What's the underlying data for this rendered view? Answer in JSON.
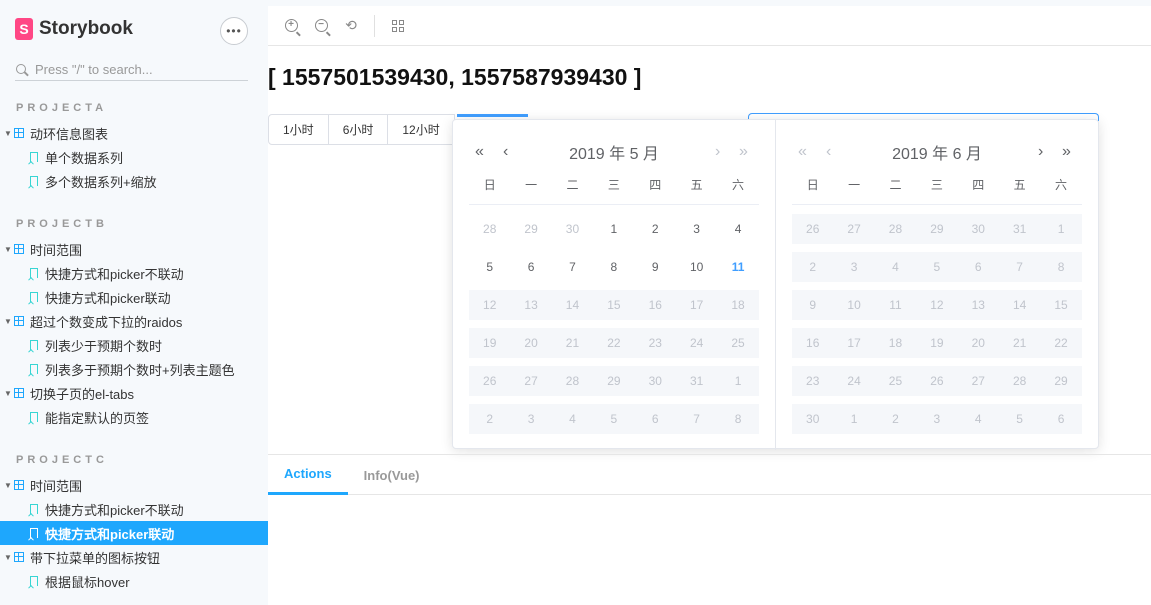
{
  "sidebar": {
    "brand": "Storybook",
    "brand_logo": "S",
    "menu_icon": "•••",
    "search_placeholder": "Press \"/\" to search...",
    "groups": [
      {
        "title": "PROJECTA"
      },
      {
        "title": "PROJECTB"
      },
      {
        "title": "PROJECTC"
      }
    ],
    "items": [
      "动环信息图表",
      "单个数据系列",
      "多个数据系列+缩放",
      "时间范围",
      "快捷方式和picker不联动",
      "快捷方式和picker联动",
      "超过个数变成下拉的raidos",
      "列表少于预期个数时",
      "列表多于预期个数时+列表主题色",
      "切换子页的el-tabs",
      "能指定默认的页签",
      "时间范围",
      "快捷方式和picker不联动",
      "快捷方式和picker联动",
      "带下拉菜单的图标按钮",
      "根据鼠标hover"
    ]
  },
  "toolbar": {
    "icons": [
      "zoom-in-icon",
      "zoom-out-icon",
      "zoom-reset-icon",
      "grid-icon"
    ]
  },
  "content": {
    "range_text": "[ 1557501539430, 1557587939430 ]",
    "quick_buttons": [
      "1小时",
      "6小时",
      "12小时"
    ]
  },
  "calendar": {
    "weekdays": [
      "日",
      "一",
      "二",
      "三",
      "四",
      "五",
      "六"
    ],
    "left": {
      "title": "2019 年 5 月",
      "rows": [
        [
          "28",
          "29",
          "30",
          "1",
          "2",
          "3",
          "4"
        ],
        [
          "5",
          "6",
          "7",
          "8",
          "9",
          "10",
          "11"
        ],
        [
          "12",
          "13",
          "14",
          "15",
          "16",
          "17",
          "18"
        ],
        [
          "19",
          "20",
          "21",
          "22",
          "23",
          "24",
          "25"
        ],
        [
          "26",
          "27",
          "28",
          "29",
          "30",
          "31",
          "1"
        ],
        [
          "2",
          "3",
          "4",
          "5",
          "6",
          "7",
          "8"
        ]
      ]
    },
    "right": {
      "title": "2019 年 6 月",
      "rows": [
        [
          "26",
          "27",
          "28",
          "29",
          "30",
          "31",
          "1"
        ],
        [
          "2",
          "3",
          "4",
          "5",
          "6",
          "7",
          "8"
        ],
        [
          "9",
          "10",
          "11",
          "12",
          "13",
          "14",
          "15"
        ],
        [
          "16",
          "17",
          "18",
          "19",
          "20",
          "21",
          "22"
        ],
        [
          "23",
          "24",
          "25",
          "26",
          "27",
          "28",
          "29"
        ],
        [
          "30",
          "1",
          "2",
          "3",
          "4",
          "5",
          "6"
        ]
      ]
    },
    "today": "11",
    "accent_color": "#409eff"
  },
  "panel": {
    "tabs": [
      "Actions",
      "Info(Vue)"
    ]
  },
  "colors": {
    "selected": "#1ea7fd",
    "brand": "#ff4785"
  }
}
